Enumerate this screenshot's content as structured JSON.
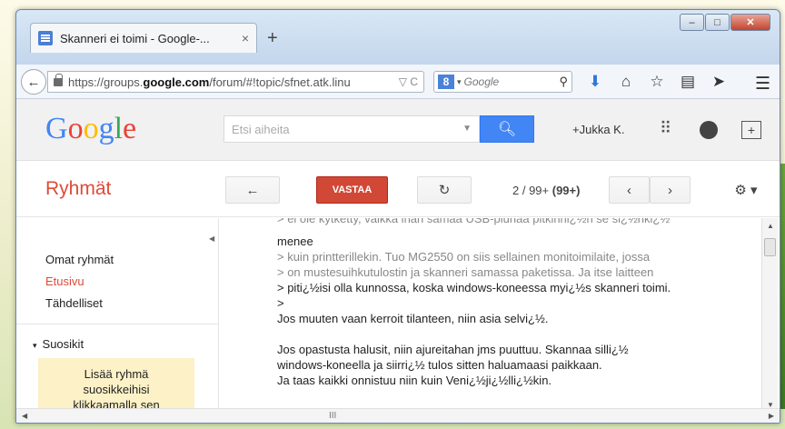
{
  "browser": {
    "tab_title": "Skanneri ei toimi - Google-...",
    "tab_close": "×",
    "new_tab": "+",
    "url_prefix": "https://groups.",
    "url_domain": "google.com",
    "url_path": "/forum/#!topic/sfnet.atk.linu",
    "url_icons": "▽ C",
    "search_engine": "8",
    "search_placeholder": "Google"
  },
  "google": {
    "logo": [
      "G",
      "o",
      "o",
      "g",
      "l",
      "e"
    ],
    "logo_colors": [
      "#4285f4",
      "#ea4335",
      "#fbbc05",
      "#4285f4",
      "#34a853",
      "#ea4335"
    ],
    "search_placeholder": "Etsi aiheita",
    "user": "+Jukka K."
  },
  "toolbar": {
    "title": "Ryhmät",
    "reply_label": "VASTAA",
    "pager_text": "2 / 99+ ",
    "pager_bold": "(99+)"
  },
  "sidebar": {
    "items": [
      "Omat ryhmät",
      "Etusivu",
      "Tähdelliset"
    ],
    "favorites_heading": "Suosikit",
    "favorites_hint": [
      "Lisää ryhmä",
      "suosikkeihisi",
      "klikkaamalla sen"
    ]
  },
  "post": {
    "lines": [
      {
        "text": "> ei ole kytketty, vaikka inan samaa USB-piuhaa pitkinni¿½n se si¿½nki¿½",
        "kind": "q"
      },
      {
        "text": "menee",
        "kind": "t"
      },
      {
        "text": "> kuin printterillekin. Tuo MG2550 on siis sellainen monitoimilaite, jossa",
        "kind": "q"
      },
      {
        "text": "> on mustesuihkutulostin ja skanneri samassa paketissa. Ja itse laitteen",
        "kind": "q"
      },
      {
        "text": "> piti¿½isi olla kunnossa, koska windows-koneessa myi¿½s skanneri toimi.",
        "kind": "t"
      },
      {
        "text": ">",
        "kind": "t"
      },
      {
        "text": "Jos muuten vaan kerroit tilanteen, niin asia selvi¿½.",
        "kind": "t"
      },
      {
        "text": "",
        "kind": "blank"
      },
      {
        "text": "Jos opastusta halusit, niin ajureitahan jms puuttuu. Skannaa silli¿½",
        "kind": "t"
      },
      {
        "text": "windows-koneella ja siirri¿½ tulos sitten haluamaasi paikkaan.",
        "kind": "t"
      },
      {
        "text": "Ja taas kaikki onnistuu niin kuin Veni¿½ji¿½lli¿½kin.",
        "kind": "t"
      }
    ]
  },
  "scrollbar": {
    "grip": "III"
  }
}
